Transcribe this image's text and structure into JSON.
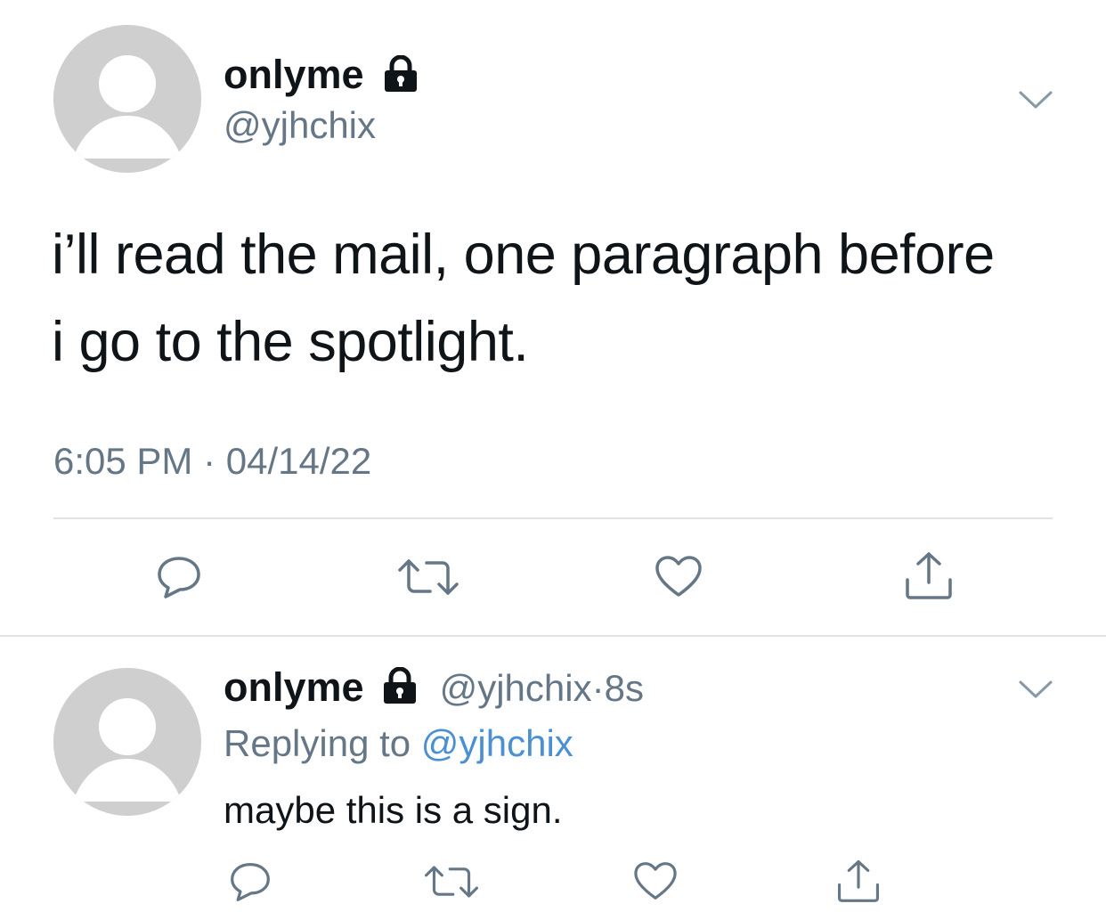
{
  "main_tweet": {
    "display_name": "onlyme",
    "handle": "@yjhchix",
    "text_line1": "i’ll read the mail, one paragraph before",
    "text_line2": "i go to the spotlight.",
    "time": "6:05 PM",
    "separator": "·",
    "date": "04/14/22",
    "icons": [
      "lock-icon",
      "chevron-down-icon",
      "reply-icon",
      "retweet-icon",
      "like-icon",
      "share-icon"
    ]
  },
  "reply_tweet": {
    "display_name": "onlyme",
    "handle": "@yjhchix",
    "separator": "·",
    "age": "8s",
    "replying_prefix": "Replying to",
    "replying_handle": "@yjhchix",
    "text": "maybe this is a sign.",
    "icons": [
      "lock-icon",
      "chevron-down-icon",
      "reply-icon",
      "retweet-icon",
      "like-icon",
      "share-icon"
    ]
  },
  "colors": {
    "text": "#0f1419",
    "secondary": "#657786",
    "link": "#4a90d2",
    "avatar_bg": "#cfcfcf",
    "divider": "#dfe3e8"
  }
}
